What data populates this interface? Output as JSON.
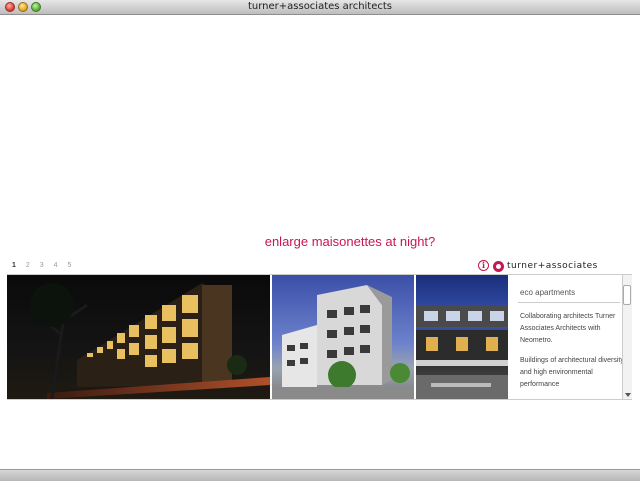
{
  "window": {
    "title": "turner+associates architects"
  },
  "headline": "enlarge maisonettes at night?",
  "pager": {
    "pages": [
      "1",
      "2",
      "3",
      "4",
      "5"
    ],
    "active": "1"
  },
  "logo": {
    "text": "turner+associates"
  },
  "project": {
    "title": "eco apartments",
    "paragraphs": [
      "Collaborating architects Turner Associates Architects with Neometro.",
      "Buildings of architectural diversity and high environmental performance"
    ]
  },
  "colors": {
    "accent": "#c8174f"
  }
}
